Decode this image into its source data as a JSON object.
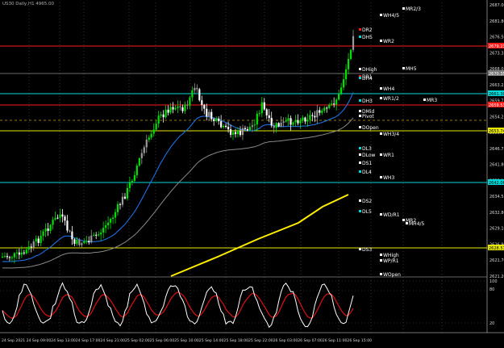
{
  "window_title": "US30 Daily,H1 4965.00",
  "colors": {
    "background": "#000000",
    "bull_candle": "#00e000",
    "bear_candle": "#ffffff",
    "neutral_candle": "#9a9a9a",
    "ema_fast": "#1e6fe0",
    "ema_mid": "#8a8a8a",
    "ema_slow": "#ffee00",
    "level_red": "#ff1a1a",
    "level_cyan": "#00d8d8",
    "level_yellow": "#e8e800",
    "grid": "#4a4a4a",
    "osc_main": "#ffffff",
    "osc_signal": "#e01010",
    "label_text": "#ffffff"
  },
  "price_axis": {
    "ticks": [
      "2687.00",
      "2681.80",
      "2676.50",
      "2673.35",
      "2668.05",
      "2663.25",
      "2659.75",
      "2654.25",
      "2650.05",
      "2646.75",
      "2641.80",
      "2638.10",
      "2634.55",
      "2632.80",
      "2629.10",
      "2626.90",
      "2621.70",
      "2621.20"
    ],
    "highlight_labels": [
      {
        "text": "2679.23",
        "color": "level_red"
      },
      {
        "text": "2670.35",
        "color": "grey"
      },
      {
        "text": "2661.30",
        "color": "level_cyan"
      },
      {
        "text": "2659.53",
        "color": "level_red"
      },
      {
        "text": "2653.74",
        "color": "level_yellow"
      },
      {
        "text": "2642.06",
        "color": "level_cyan"
      },
      {
        "text": "2628.57",
        "color": "level_yellow"
      }
    ]
  },
  "time_axis": [
    "24 Sep 2021",
    "24 Sep 09:00",
    "24 Sep 13:00",
    "24 Sep 17:00",
    "24 Sep 21:00",
    "25 Sep 02:00",
    "25 Sep 06:00",
    "25 Sep 10:00",
    "25 Sep 14:00",
    "25 Sep 18:00",
    "25 Sep 22:00",
    "26 Sep 03:00",
    "26 Sep 07:00",
    "26 Sep 11:00",
    "26 Sep 15:00"
  ],
  "oscillator_axis": [
    "100",
    "80",
    "20"
  ],
  "pivot_labels": [
    {
      "text": "MR2/3",
      "color": "white"
    },
    {
      "text": "WH4/5",
      "color": "white"
    },
    {
      "text": "DR2",
      "color": "level_red"
    },
    {
      "text": "DH5",
      "color": "cyan"
    },
    {
      "text": "WR2",
      "color": "white"
    },
    {
      "text": "MH5",
      "color": "white"
    },
    {
      "text": "DHigh",
      "color": "white"
    },
    {
      "text": "DR1",
      "color": "level_red"
    },
    {
      "text": "DH4",
      "color": "cyan"
    },
    {
      "text": "WH4",
      "color": "white"
    },
    {
      "text": "WR1/2",
      "color": "white"
    },
    {
      "text": "MR3",
      "color": "white"
    },
    {
      "text": "DH3",
      "color": "cyan"
    },
    {
      "text": "DMid",
      "color": "white"
    },
    {
      "text": "Pivot",
      "color": "white"
    },
    {
      "text": "DOpen",
      "color": "white"
    },
    {
      "text": "WH3/4",
      "color": "white"
    },
    {
      "text": "DL3",
      "color": "cyan"
    },
    {
      "text": "DLow",
      "color": "white"
    },
    {
      "text": "WR1",
      "color": "white"
    },
    {
      "text": "DS1",
      "color": "white"
    },
    {
      "text": "DL4",
      "color": "cyan"
    },
    {
      "text": "WH3",
      "color": "white"
    },
    {
      "text": "DS2",
      "color": "white"
    },
    {
      "text": "DL5",
      "color": "cyan"
    },
    {
      "text": "WD/R1",
      "color": "white"
    },
    {
      "text": "MR2",
      "color": "white"
    },
    {
      "text": "MH4/5",
      "color": "white"
    },
    {
      "text": "DS3",
      "color": "white"
    },
    {
      "text": "WHigh",
      "color": "white"
    },
    {
      "text": "WP/R1",
      "color": "white"
    },
    {
      "text": "WOpen",
      "color": "white"
    }
  ]
}
